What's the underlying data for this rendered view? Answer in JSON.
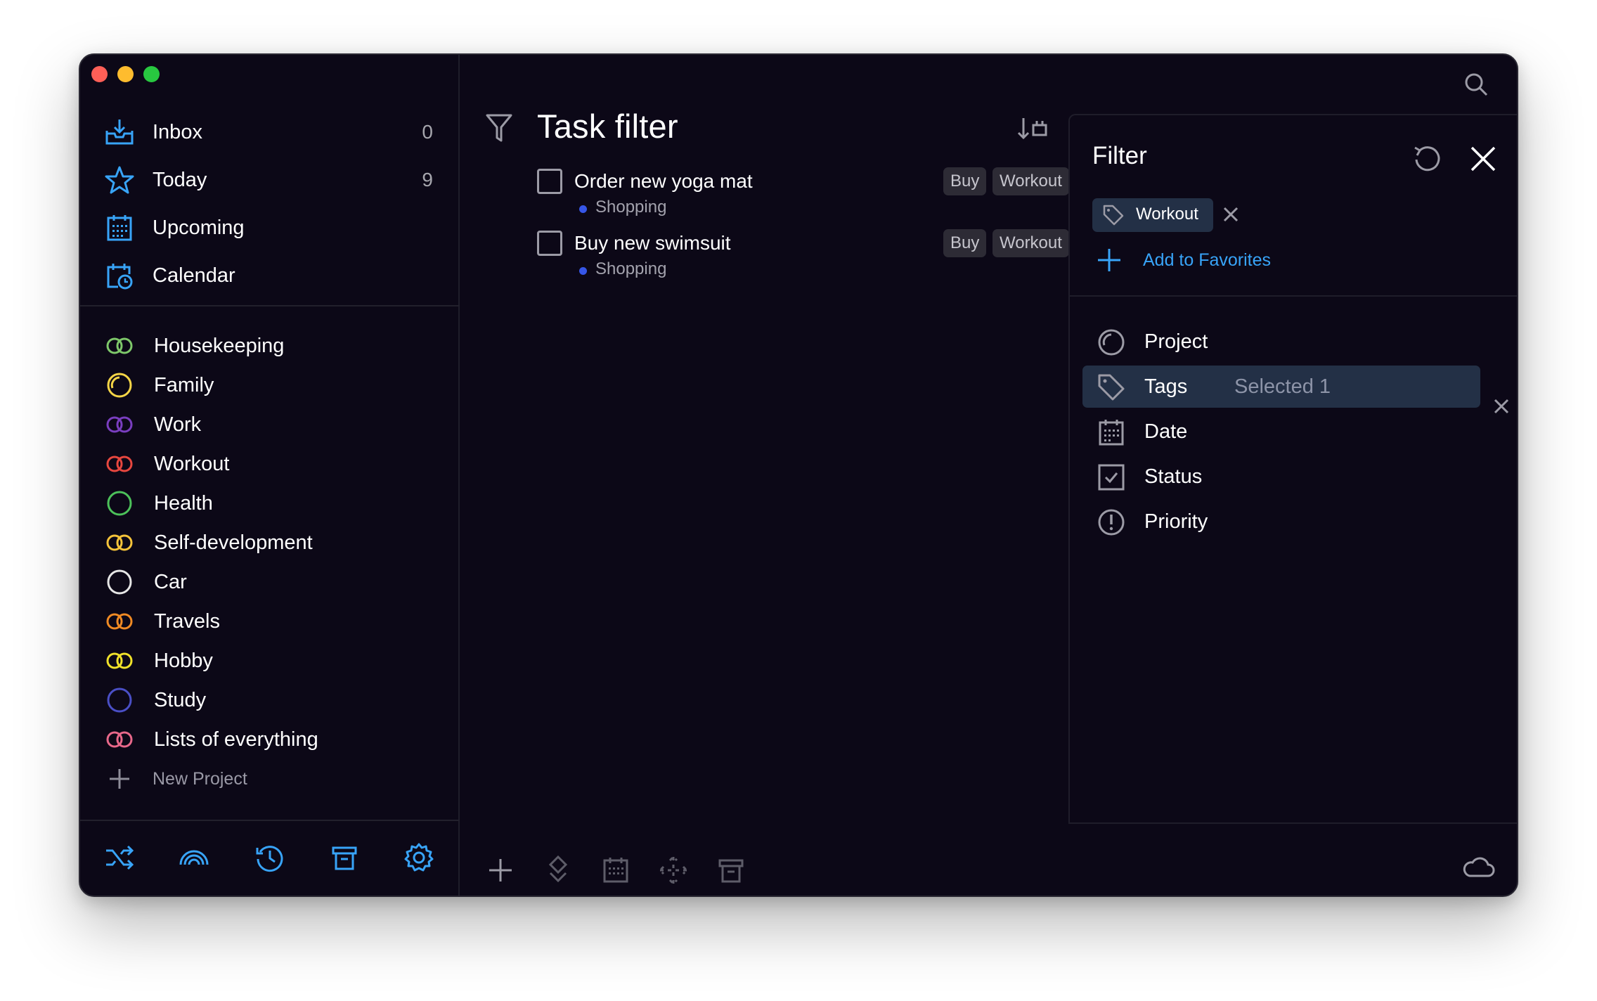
{
  "window": {
    "colors": {
      "background": "#0c0817",
      "accent": "#38a4f8",
      "selected": "#233046"
    }
  },
  "sidebar": {
    "nav": [
      {
        "label": "Inbox",
        "count": "0",
        "icon": "inbox-icon"
      },
      {
        "label": "Today",
        "count": "9",
        "icon": "star-icon"
      },
      {
        "label": "Upcoming",
        "count": "",
        "icon": "calendar-grid-icon"
      },
      {
        "label": "Calendar",
        "count": "",
        "icon": "calendar-clock-icon"
      }
    ],
    "projects": [
      {
        "label": "Housekeeping",
        "color": "#7ec86a",
        "icon": "double-ring-icon"
      },
      {
        "label": "Family",
        "color": "#f5d547",
        "icon": "circle-progress-icon"
      },
      {
        "label": "Work",
        "color": "#7a3ec0",
        "icon": "double-ring-icon"
      },
      {
        "label": "Workout",
        "color": "#e8473f",
        "icon": "double-ring-icon"
      },
      {
        "label": "Health",
        "color": "#4cc15a",
        "icon": "circle-icon"
      },
      {
        "label": "Self-development",
        "color": "#f5c33a",
        "icon": "double-ring-icon"
      },
      {
        "label": "Car",
        "color": "#e6e6e6",
        "icon": "circle-icon"
      },
      {
        "label": "Travels",
        "color": "#f08a24",
        "icon": "double-ring-icon"
      },
      {
        "label": "Hobby",
        "color": "#f0e12a",
        "icon": "double-ring-icon"
      },
      {
        "label": "Study",
        "color": "#4a4fc6",
        "icon": "circle-icon"
      },
      {
        "label": "Lists of everything",
        "color": "#e8688a",
        "icon": "double-ring-icon"
      }
    ],
    "new_project": "New Project",
    "bottom_icons": [
      "shuffle-icon",
      "rainbow-icon",
      "history-icon",
      "trash-icon",
      "settings-icon"
    ]
  },
  "main": {
    "title": "Task filter",
    "toolbar": [
      "search-icon",
      "calendar-icon",
      "filter-icon",
      "tag-icon",
      "coffee-icon",
      "focus-icon",
      "bell-icon",
      "timer-icon",
      "windows-icon"
    ],
    "tasks": [
      {
        "name": "Order new yoga mat",
        "project": "Shopping",
        "tags": [
          "Buy",
          "Workout"
        ]
      },
      {
        "name": "Buy new swimsuit",
        "project": "Shopping",
        "tags": [
          "Buy",
          "Workout"
        ]
      }
    ],
    "bottom_icons": [
      "plus-icon",
      "priority-icon",
      "calendar-icon",
      "move-icon",
      "trash-icon"
    ]
  },
  "filter": {
    "title": "Filter",
    "active_tag": "Workout",
    "add_favorites": "Add to Favorites",
    "rows": [
      {
        "label": "Project",
        "sub": "",
        "icon": "project-icon"
      },
      {
        "label": "Tags",
        "sub": "Selected 1",
        "icon": "tag-icon"
      },
      {
        "label": "Date",
        "sub": "",
        "icon": "calendar-icon"
      },
      {
        "label": "Status",
        "sub": "",
        "icon": "checkbox-icon"
      },
      {
        "label": "Priority",
        "sub": "",
        "icon": "priority-icon"
      }
    ]
  }
}
